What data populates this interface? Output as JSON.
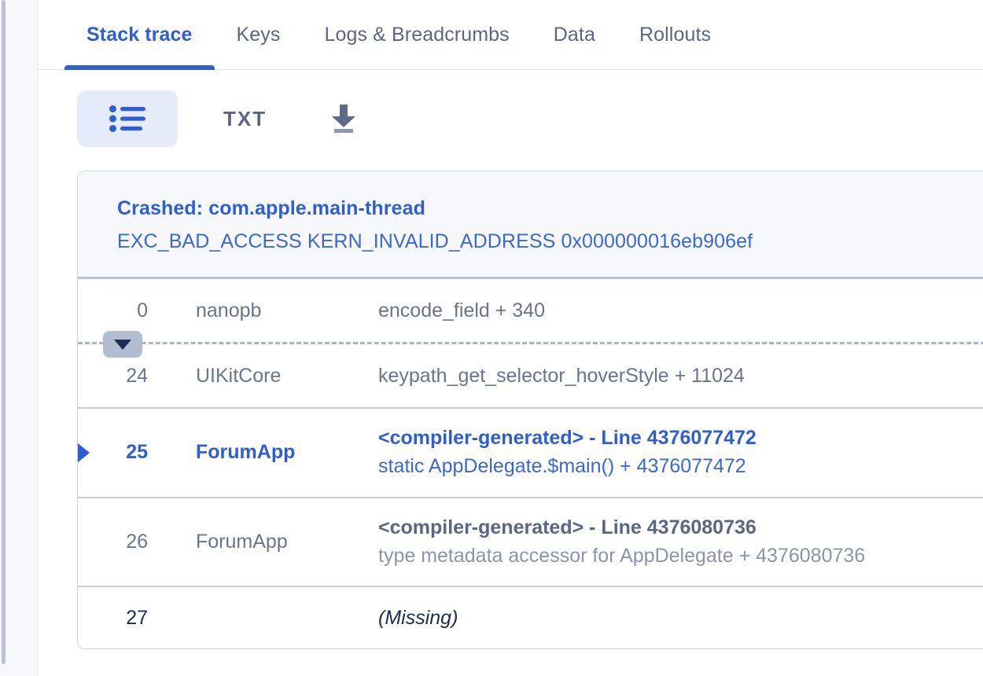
{
  "tabs": [
    {
      "id": "stack-trace",
      "label": "Stack trace",
      "active": true
    },
    {
      "id": "keys",
      "label": "Keys",
      "active": false
    },
    {
      "id": "logs-breadcrumbs",
      "label": "Logs & Breadcrumbs",
      "active": false
    },
    {
      "id": "data",
      "label": "Data",
      "active": false
    },
    {
      "id": "rollouts",
      "label": "Rollouts",
      "active": false
    }
  ],
  "toolbar": {
    "list_view_icon": "bulleted-list-icon",
    "txt_label": "TXT",
    "download_icon": "download-icon"
  },
  "crash": {
    "title": "Crashed: com.apple.main-thread",
    "subtitle": "EXC_BAD_ACCESS KERN_INVALID_ADDRESS 0x000000016eb906ef"
  },
  "collapsed_frames": {
    "expand_icon": "chevron-down-icon"
  },
  "frames": [
    {
      "index": "0",
      "package": "nanopb",
      "symbol": "encode_field + 340",
      "symbol_sub": "",
      "app": false,
      "missing": false,
      "marker": false
    },
    {
      "index": "24",
      "package": "UIKitCore",
      "symbol": "keypath_get_selector_hoverStyle + 11024",
      "symbol_sub": "",
      "app": false,
      "missing": false,
      "marker": false
    },
    {
      "index": "25",
      "package": "ForumApp",
      "symbol": "<compiler-generated> - Line 4376077472",
      "symbol_sub": "static AppDelegate.$main() + 4376077472",
      "app": true,
      "missing": false,
      "marker": true
    },
    {
      "index": "26",
      "package": "ForumApp",
      "symbol": "<compiler-generated> - Line 4376080736",
      "symbol_sub": "type metadata accessor for AppDelegate + 4376080736",
      "app": false,
      "missing": false,
      "marker": false
    },
    {
      "index": "27",
      "package": "",
      "symbol": "(Missing)",
      "symbol_sub": "",
      "app": false,
      "missing": true,
      "marker": false
    }
  ],
  "colors": {
    "accent_blue": "#2f5ed0",
    "link_blue": "#3a67d4",
    "text_slate": "#6a7490",
    "text_slate_dark": "#5b6584",
    "text_slate_light": "#8b94ac",
    "text_navy": "#1e2b4d",
    "card_border": "#cdd4e3",
    "row_border": "#c6cdde",
    "header_bg": "#f6f8fc",
    "toggle_active_bg": "#e5ebf9",
    "rail_bg": "#f7f8fb",
    "scrollbar": "#b9c2d4",
    "divider_dash": "#aab3c8",
    "expand_btn_bg": "#b3bdd2"
  }
}
